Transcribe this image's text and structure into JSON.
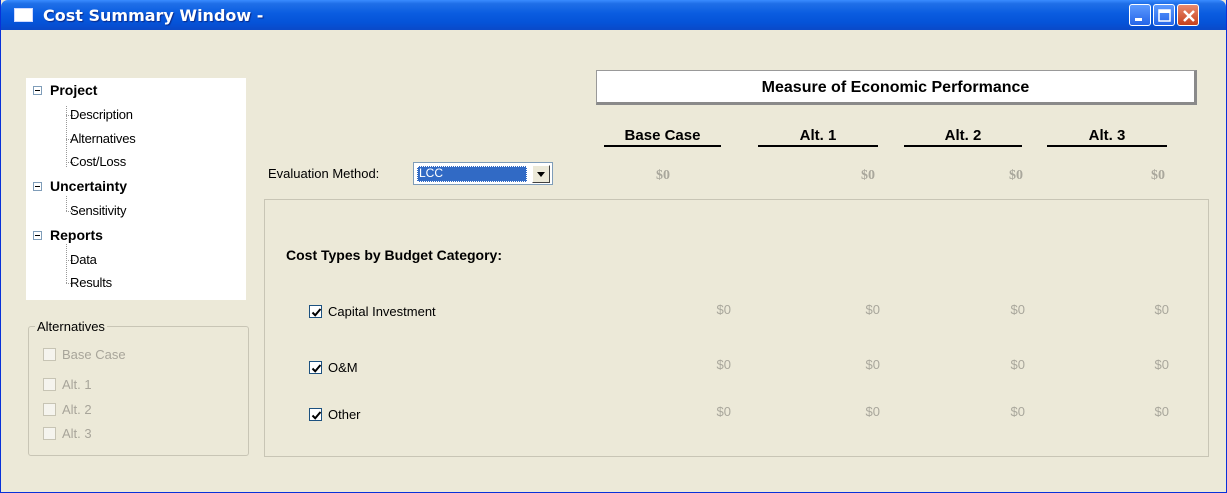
{
  "window": {
    "title": "Cost Summary Window -"
  },
  "tree": {
    "groups": [
      {
        "label": "Project",
        "children": [
          "Description",
          "Alternatives",
          "Cost/Loss"
        ]
      },
      {
        "label": "Uncertainty",
        "children": [
          "Sensitivity"
        ]
      },
      {
        "label": "Reports",
        "children": [
          "Data",
          "Results"
        ]
      }
    ]
  },
  "alternatives_group": {
    "legend": "Alternatives",
    "items": [
      "Base Case",
      "Alt. 1",
      "Alt. 2",
      "Alt. 3"
    ]
  },
  "measure": {
    "header": "Measure of Economic Performance",
    "columns": [
      "Base Case",
      "Alt. 1",
      "Alt. 2",
      "Alt. 3"
    ],
    "evaluation_label": "Evaluation Method:",
    "evaluation_value": "LCC",
    "values": [
      "$0",
      "$0",
      "$0",
      "$0"
    ]
  },
  "cost_types": {
    "title": "Cost Types by Budget Category:",
    "rows": [
      {
        "label": "Capital Investment",
        "checked": true,
        "values": [
          "$0",
          "$0",
          "$0",
          "$0"
        ]
      },
      {
        "label": "O&M",
        "checked": true,
        "values": [
          "$0",
          "$0",
          "$0",
          "$0"
        ]
      },
      {
        "label": "Other",
        "checked": true,
        "values": [
          "$0",
          "$0",
          "$0",
          "$0"
        ]
      }
    ]
  }
}
